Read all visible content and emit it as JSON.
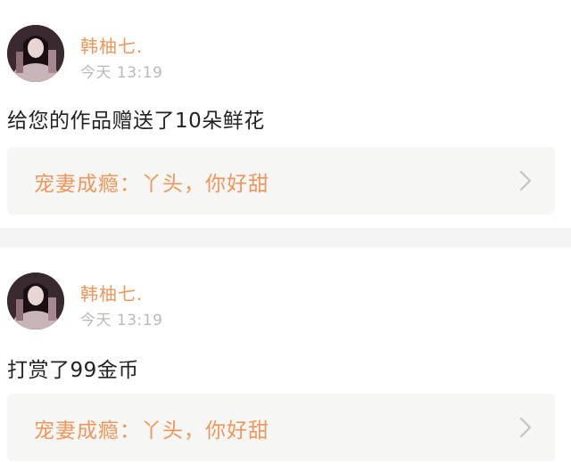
{
  "colors": {
    "accent": "#f0965a",
    "text": "#222222",
    "muted": "#b9b9b9",
    "quote_bg": "#f6f6f4"
  },
  "posts": [
    {
      "username": "韩柚七.",
      "time": "今天 13:19",
      "message": "给您的作品赠送了10朵鲜花",
      "quote": "宠妻成瘾：丫头，你好甜",
      "icons": {
        "avatar": "user-avatar",
        "arrow": "chevron-right-icon"
      }
    },
    {
      "username": "韩柚七.",
      "time": "今天 13:19",
      "message": "打赏了99金币",
      "quote": "宠妻成瘾：丫头，你好甜",
      "icons": {
        "avatar": "user-avatar",
        "arrow": "chevron-right-icon"
      }
    }
  ]
}
